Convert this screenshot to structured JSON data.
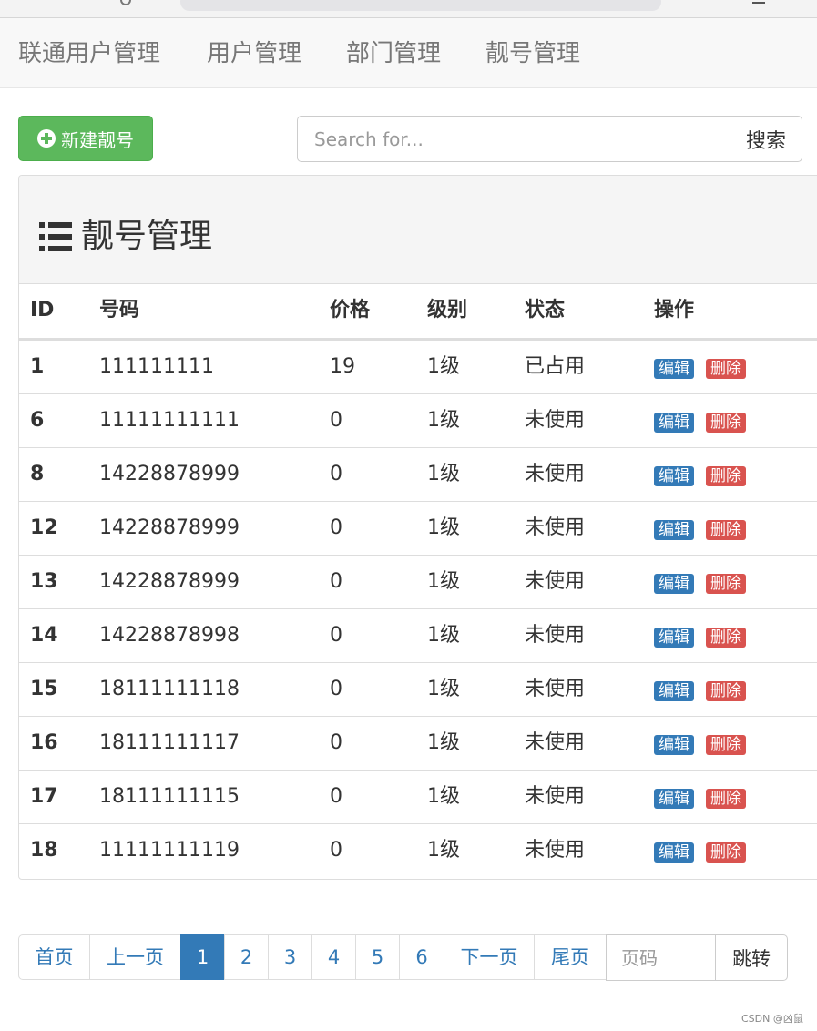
{
  "navbar": {
    "items": [
      {
        "label": "联通用户管理"
      },
      {
        "label": "用户管理"
      },
      {
        "label": "部门管理"
      },
      {
        "label": "靓号管理"
      }
    ]
  },
  "toolbar": {
    "new_button_label": "新建靓号",
    "new_button_icon": "plus-circle-icon",
    "search_placeholder": "Search for...",
    "search_value": "",
    "search_button_label": "搜索"
  },
  "panel": {
    "title": "靓号管理",
    "title_icon": "list-icon"
  },
  "table": {
    "columns": [
      "ID",
      "号码",
      "价格",
      "级别",
      "状态",
      "操作"
    ],
    "rows": [
      {
        "id": "1",
        "mobile": "111111111",
        "price": "19",
        "level": "1级",
        "status": "已占用",
        "edit": "编辑",
        "delete": "删除"
      },
      {
        "id": "6",
        "mobile": "11111111111",
        "price": "0",
        "level": "1级",
        "status": "未使用",
        "edit": "编辑",
        "delete": "删除"
      },
      {
        "id": "8",
        "mobile": "14228878999",
        "price": "0",
        "level": "1级",
        "status": "未使用",
        "edit": "编辑",
        "delete": "删除"
      },
      {
        "id": "12",
        "mobile": "14228878999",
        "price": "0",
        "level": "1级",
        "status": "未使用",
        "edit": "编辑",
        "delete": "删除"
      },
      {
        "id": "13",
        "mobile": "14228878999",
        "price": "0",
        "level": "1级",
        "status": "未使用",
        "edit": "编辑",
        "delete": "删除"
      },
      {
        "id": "14",
        "mobile": "14228878998",
        "price": "0",
        "level": "1级",
        "status": "未使用",
        "edit": "编辑",
        "delete": "删除"
      },
      {
        "id": "15",
        "mobile": "18111111118",
        "price": "0",
        "level": "1级",
        "status": "未使用",
        "edit": "编辑",
        "delete": "删除"
      },
      {
        "id": "16",
        "mobile": "18111111117",
        "price": "0",
        "level": "1级",
        "status": "未使用",
        "edit": "编辑",
        "delete": "删除"
      },
      {
        "id": "17",
        "mobile": "18111111115",
        "price": "0",
        "level": "1级",
        "status": "未使用",
        "edit": "编辑",
        "delete": "删除"
      },
      {
        "id": "18",
        "mobile": "11111111119",
        "price": "0",
        "level": "1级",
        "status": "未使用",
        "edit": "编辑",
        "delete": "删除"
      }
    ]
  },
  "pagination": {
    "items": [
      {
        "label": "首页",
        "active": false
      },
      {
        "label": "上一页",
        "active": false
      },
      {
        "label": "1",
        "active": true
      },
      {
        "label": "2",
        "active": false
      },
      {
        "label": "3",
        "active": false
      },
      {
        "label": "4",
        "active": false
      },
      {
        "label": "5",
        "active": false
      },
      {
        "label": "6",
        "active": false
      },
      {
        "label": "下一页",
        "active": false
      },
      {
        "label": "尾页",
        "active": false
      }
    ],
    "page_input_placeholder": "页码",
    "page_input_value": "",
    "jump_label": "跳转"
  },
  "watermark": "CSDN @凶鼠",
  "colors": {
    "primary": "#337ab7",
    "success": "#5cb85c",
    "danger": "#d9534f"
  }
}
